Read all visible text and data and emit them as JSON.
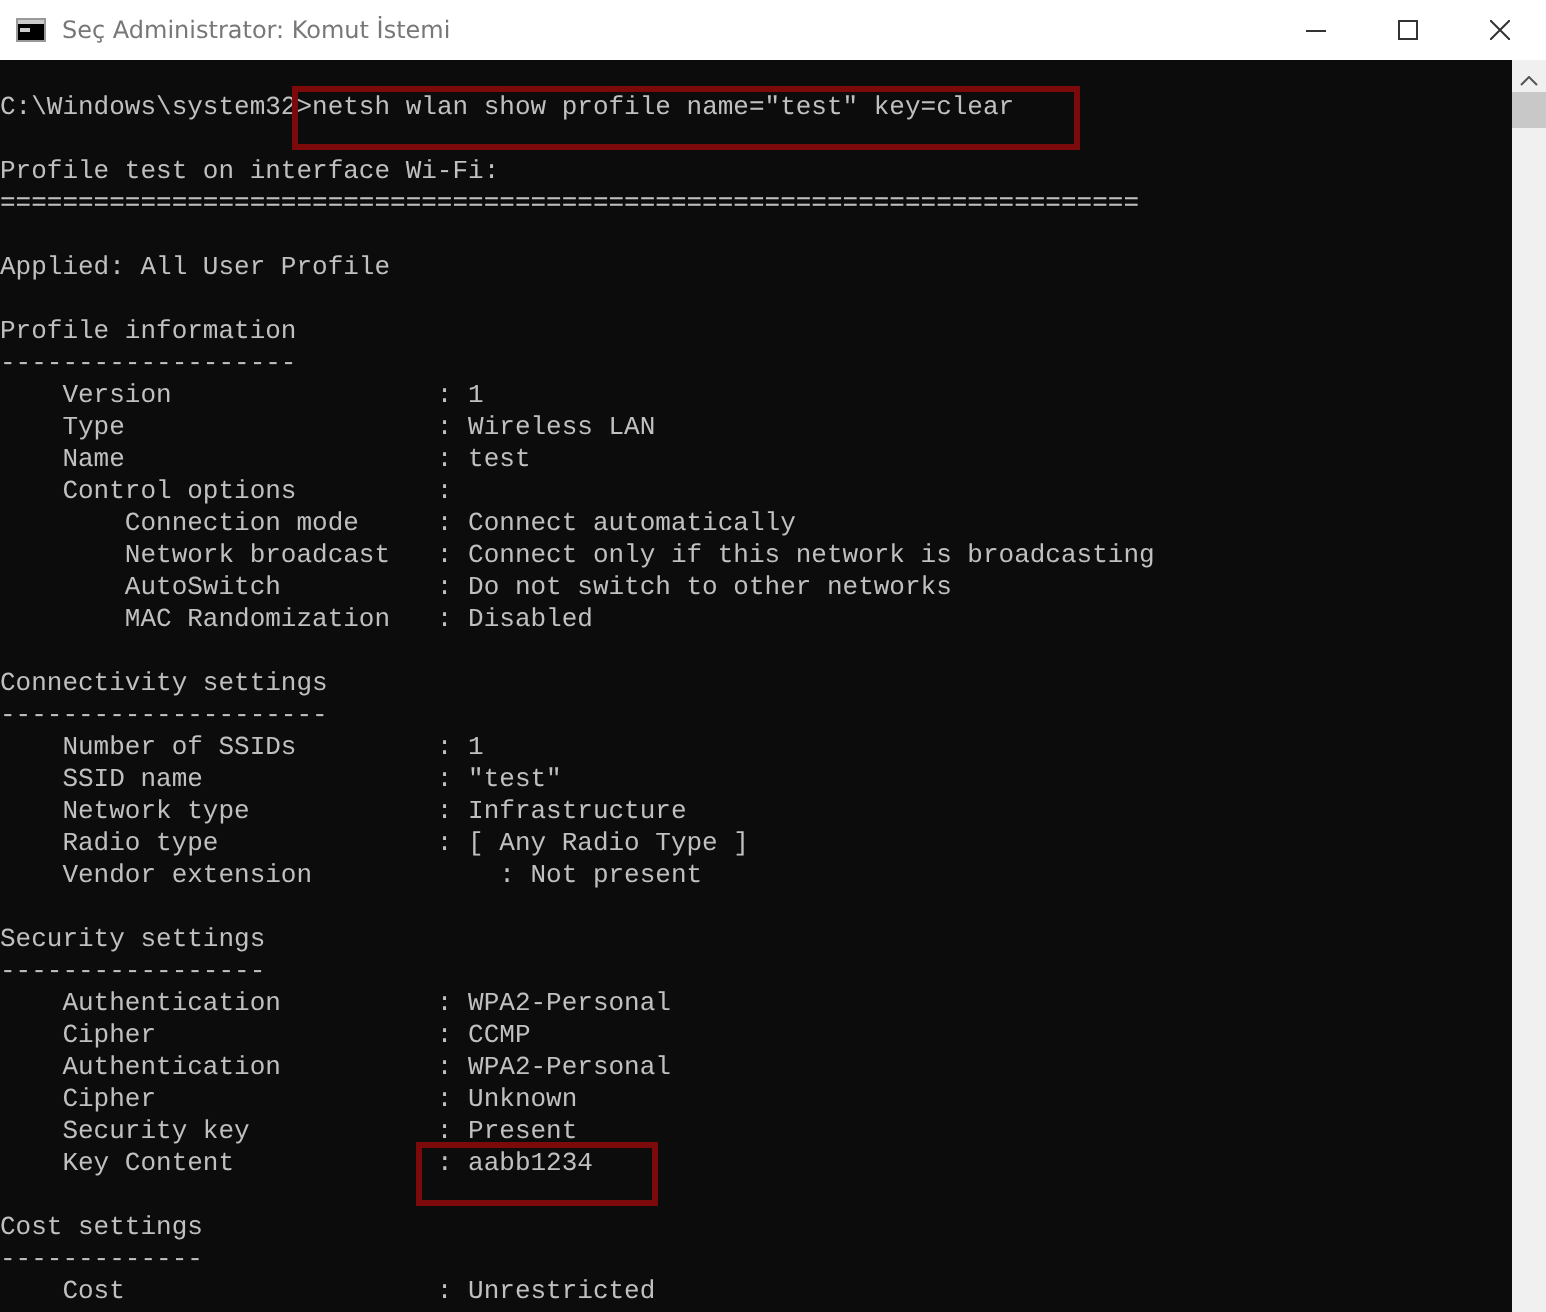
{
  "window": {
    "title": "Seç Administrator: Komut İstemi"
  },
  "console": {
    "blocks": [
      {
        "lines": [
          {
            "segments": [
              {
                "text": "C:\\Windows\\system32>",
                "highlighted": false
              },
              {
                "text": "netsh wlan show profile name=\"test\" key=clear",
                "highlighted": true
              }
            ]
          }
        ]
      },
      {
        "lines": [
          {
            "segments": [
              {
                "text": "Profile test on interface Wi-Fi:",
                "highlighted": false
              }
            ]
          },
          {
            "segments": [
              {
                "text": "=========================================================================",
                "highlighted": false
              }
            ]
          }
        ]
      },
      {
        "lines": [
          {
            "segments": [
              {
                "text": "Applied: All User Profile",
                "highlighted": false
              }
            ]
          }
        ]
      },
      {
        "lines": [
          {
            "segments": [
              {
                "text": "Profile information",
                "highlighted": false
              }
            ]
          },
          {
            "segments": [
              {
                "text": "-------------------",
                "highlighted": false
              }
            ]
          },
          {
            "segments": [
              {
                "text": "    Version                 : 1",
                "highlighted": false
              }
            ]
          },
          {
            "segments": [
              {
                "text": "    Type                    : Wireless LAN",
                "highlighted": false
              }
            ]
          },
          {
            "segments": [
              {
                "text": "    Name                    : test",
                "highlighted": false
              }
            ]
          },
          {
            "segments": [
              {
                "text": "    Control options         :",
                "highlighted": false
              }
            ]
          },
          {
            "segments": [
              {
                "text": "        Connection mode     : Connect automatically",
                "highlighted": false
              }
            ]
          },
          {
            "segments": [
              {
                "text": "        Network broadcast   : Connect only if this network is broadcasting",
                "highlighted": false
              }
            ]
          },
          {
            "segments": [
              {
                "text": "        AutoSwitch          : Do not switch to other networks",
                "highlighted": false
              }
            ]
          },
          {
            "segments": [
              {
                "text": "        MAC Randomization   : Disabled",
                "highlighted": false
              }
            ]
          }
        ]
      },
      {
        "lines": [
          {
            "segments": [
              {
                "text": "Connectivity settings",
                "highlighted": false
              }
            ]
          },
          {
            "segments": [
              {
                "text": "---------------------",
                "highlighted": false
              }
            ]
          },
          {
            "segments": [
              {
                "text": "    Number of SSIDs         : 1",
                "highlighted": false
              }
            ]
          },
          {
            "segments": [
              {
                "text": "    SSID name               : \"test\"",
                "highlighted": false
              }
            ]
          },
          {
            "segments": [
              {
                "text": "    Network type            : Infrastructure",
                "highlighted": false
              }
            ]
          },
          {
            "segments": [
              {
                "text": "    Radio type              : [ Any Radio Type ]",
                "highlighted": false
              }
            ]
          },
          {
            "segments": [
              {
                "text": "    Vendor extension            : Not present",
                "highlighted": false
              }
            ]
          }
        ]
      },
      {
        "lines": [
          {
            "segments": [
              {
                "text": "Security settings",
                "highlighted": false
              }
            ]
          },
          {
            "segments": [
              {
                "text": "-----------------",
                "highlighted": false
              }
            ]
          },
          {
            "segments": [
              {
                "text": "    Authentication          : WPA2-Personal",
                "highlighted": false
              }
            ]
          },
          {
            "segments": [
              {
                "text": "    Cipher                  : CCMP",
                "highlighted": false
              }
            ]
          },
          {
            "segments": [
              {
                "text": "    Authentication          : WPA2-Personal",
                "highlighted": false
              }
            ]
          },
          {
            "segments": [
              {
                "text": "    Cipher                  : Unknown",
                "highlighted": false
              }
            ]
          },
          {
            "segments": [
              {
                "text": "    Security key            : Present",
                "highlighted": false
              }
            ]
          },
          {
            "segments": [
              {
                "text": "    Key Content             ",
                "highlighted": false
              },
              {
                "text": ": aabb1234",
                "highlighted": true
              }
            ]
          }
        ]
      },
      {
        "lines": [
          {
            "segments": [
              {
                "text": "Cost settings",
                "highlighted": false
              }
            ]
          },
          {
            "segments": [
              {
                "text": "-------------",
                "highlighted": false
              }
            ]
          },
          {
            "segments": [
              {
                "text": "    Cost                    : Unrestricted",
                "highlighted": false
              }
            ]
          }
        ]
      }
    ]
  }
}
